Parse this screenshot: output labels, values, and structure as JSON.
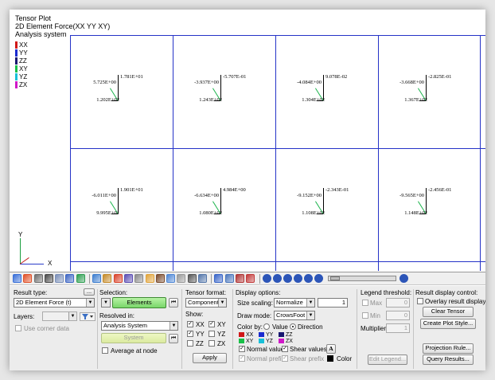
{
  "viewport": {
    "title_lines": [
      "Tensor Plot",
      "2D Element Force(XX YY XY)",
      "Analysis system"
    ],
    "legend": [
      {
        "label": "XX",
        "color": "#d01818"
      },
      {
        "label": "YY",
        "color": "#1a2bd0"
      },
      {
        "label": "ZZ",
        "color": "#181870"
      },
      {
        "label": "XY",
        "color": "#18c048"
      },
      {
        "label": "YZ",
        "color": "#18c0d8"
      },
      {
        "label": "ZX",
        "color": "#d018c8"
      }
    ],
    "grid_color": "#2533c7",
    "cells": [
      {
        "top": "1.781E+01",
        "mid": "5.725E+00",
        "bot": "1.202E+02"
      },
      {
        "top": "-5.707E-01",
        "mid": "-3.937E+00",
        "bot": "1.243E+02"
      },
      {
        "top": "9.078E-02",
        "mid": "-4.084E+00",
        "bot": "1.304E+02"
      },
      {
        "top": "-2.825E-01",
        "mid": "-3.668E+00",
        "bot": "1.367E+02"
      },
      {
        "top": "1.901E+01",
        "mid": "-6.011E+00",
        "bot": "9.995E+01"
      },
      {
        "top": "4.984E+00",
        "mid": "-6.634E+00",
        "bot": "1.080E+02"
      },
      {
        "top": "-2.343E-01",
        "mid": "-9.152E+00",
        "bot": "1.108E+02"
      },
      {
        "top": "-2.456E-01",
        "mid": "-9.565E+00",
        "bot": "1.148E+02"
      }
    ],
    "axes": {
      "y": "Y",
      "x": "X"
    }
  },
  "panel": {
    "result_type": {
      "label": "Result type:",
      "value": "2D Element Force (t)",
      "more": "..."
    },
    "layers": {
      "label": "Layers:",
      "value": ""
    },
    "use_corner_data": "Use corner data",
    "selection": {
      "label": "Selection:",
      "button": "Elements"
    },
    "resolved_in": {
      "label": "Resolved in:",
      "value": "Analysis System",
      "system_button": "System"
    },
    "average_at_node": "Average at node",
    "tensor_format": {
      "label": "Tensor format:",
      "value": "Component"
    },
    "show": {
      "label": "Show:",
      "items": [
        {
          "label": "XX",
          "checked": true
        },
        {
          "label": "XY",
          "checked": true
        },
        {
          "label": "YY",
          "checked": true
        },
        {
          "label": "YZ",
          "checked": false
        },
        {
          "label": "ZZ",
          "checked": false
        },
        {
          "label": "ZX",
          "checked": false
        }
      ]
    },
    "apply": "Apply",
    "display_options": {
      "label": "Display options:",
      "size_scaling_label": "Size scaling:",
      "size_scaling_value": "Normalize",
      "size_scaling_number": "1",
      "draw_mode_label": "Draw mode:",
      "draw_mode_value": "CrowsFoot",
      "color_by_label": "Color by:",
      "color_by_value": "Value",
      "color_by_direction": "Direction",
      "swatches": [
        {
          "label": "XX",
          "color": "#d01818"
        },
        {
          "label": "YY",
          "color": "#1a2bd0"
        },
        {
          "label": "ZZ",
          "color": "#181870"
        },
        {
          "label": "XY",
          "color": "#18c048"
        },
        {
          "label": "YZ",
          "color": "#18c0d8"
        },
        {
          "label": "ZX",
          "color": "#d018c8"
        }
      ],
      "normal_values": "Normal values",
      "shear_values": "Shear values",
      "normal_prefix": "Normal prefix",
      "shear_prefix": "Shear prefix",
      "font_glyph": "A",
      "color_label": "Color"
    },
    "legend_threshold": {
      "label": "Legend threshold:",
      "max_label": "Max",
      "max_value": "0",
      "min_label": "Min",
      "min_value": "0",
      "multiplier_label": "Multiplier:",
      "multiplier_value": "1",
      "edit_legend": "Edit Legend..."
    },
    "result_display_control": {
      "label": "Result display control:",
      "overlay": "Overlay result display",
      "clear_tensor": "Clear Tensor",
      "create_plot_style": "Create Plot Style...",
      "projection_rule": "Projection Rule...",
      "query_results": "Query Results..."
    }
  }
}
